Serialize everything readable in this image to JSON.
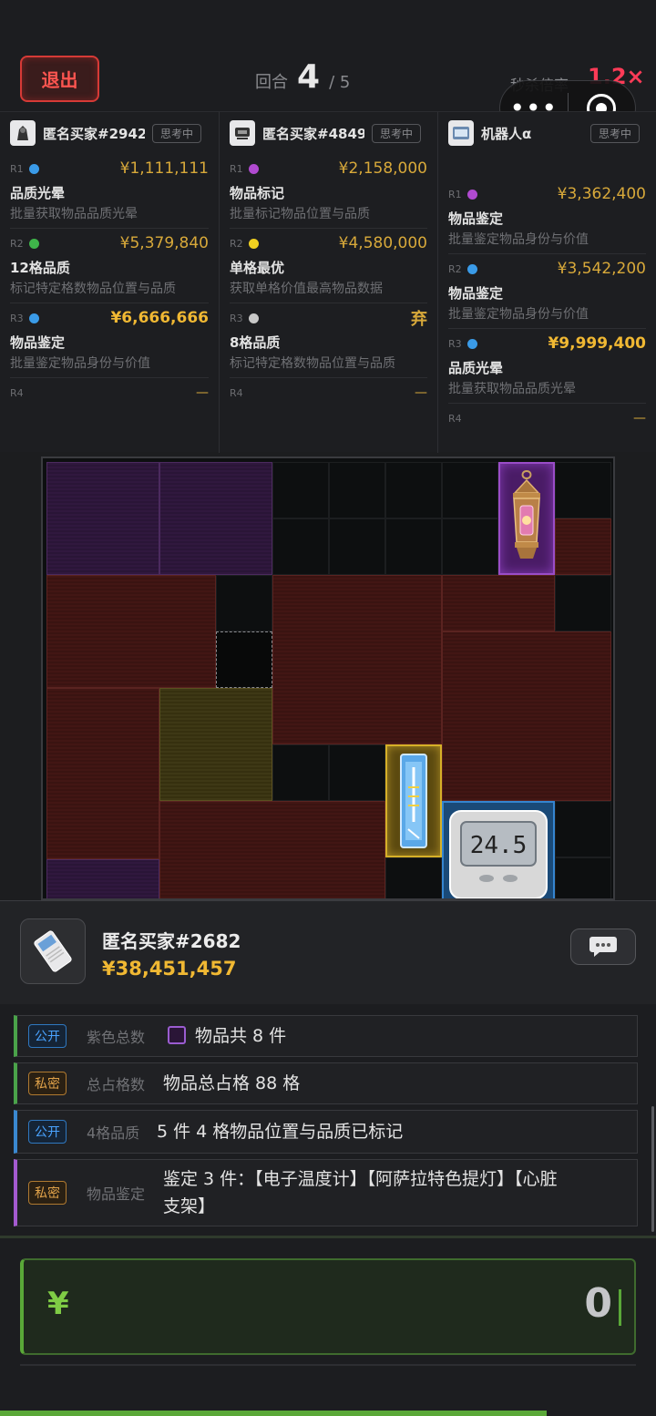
{
  "header": {
    "exit_label": "退出",
    "round_label": "回合",
    "round_current": "4",
    "round_total": "/ 5",
    "speed_label": "秒杀倍率",
    "speed_value": "1.2×",
    "capsule_dots": "•••"
  },
  "buyers": [
    {
      "name": "匿名买家#2942",
      "status": "思考中",
      "rounds": [
        {
          "label": "R1",
          "dot": "#3a9be8",
          "price": "¥1,111,111",
          "title": "品质光晕",
          "desc": "批量获取物品品质光晕"
        },
        {
          "label": "R2",
          "dot": "#3fb54a",
          "price": "¥5,379,840",
          "title": "12格品质",
          "desc": "标记特定格数物品位置与品质"
        },
        {
          "label": "R3",
          "dot": "#3a9be8",
          "price": "¥6,666,666",
          "title": "物品鉴定",
          "desc": "批量鉴定物品身份与价值"
        },
        {
          "label": "R4",
          "price": "—"
        }
      ]
    },
    {
      "name": "匿名买家#4849",
      "status": "思考中",
      "rounds": [
        {
          "label": "R1",
          "dot": "#b04ad0",
          "price": "¥2,158,000",
          "title": "物品标记",
          "desc": "批量标记物品位置与品质"
        },
        {
          "label": "R2",
          "dot": "#f0d020",
          "price": "¥4,580,000",
          "title": "单格最优",
          "desc": "获取单格价值最高物品数据"
        },
        {
          "label": "R3",
          "dot": "#c8c8c8",
          "price": "弃",
          "title": "8格品质",
          "desc": "标记特定格数物品位置与品质"
        },
        {
          "label": "R4",
          "price": "—"
        }
      ]
    },
    {
      "name": "机器人α",
      "status": "思考中",
      "rounds": [
        {
          "label": "R1",
          "dot": "#b04ad0",
          "price": "¥3,362,400",
          "title": "物品鉴定",
          "desc": "批量鉴定物品身份与价值"
        },
        {
          "label": "R2",
          "dot": "#3a9be8",
          "price": "¥3,542,200",
          "title": "物品鉴定",
          "desc": "批量鉴定物品身份与价值"
        },
        {
          "label": "R3",
          "dot": "#3a9be8",
          "price": "¥9,999,400",
          "title": "品质光晕",
          "desc": "批量获取物品品质光晕"
        },
        {
          "label": "R4",
          "price": "—"
        }
      ]
    }
  ],
  "board": {
    "items": [
      {
        "name": "阿萨拉特色提灯",
        "quality": "purple"
      },
      {
        "name": "心脏支架",
        "quality": "gold"
      },
      {
        "name": "电子温度计",
        "quality": "blue",
        "display": "24.5"
      }
    ]
  },
  "bidder": {
    "name": "匿名买家#2682",
    "total": "¥38,451,457"
  },
  "clues": [
    {
      "tag": "公开",
      "category": "紫色总数",
      "text": "物品共 8 件"
    },
    {
      "tag": "私密",
      "category": "总占格数",
      "text": "物品总占格 88 格"
    },
    {
      "tag": "公开",
      "category": "4格品质",
      "text": "5 件 4 格物品位置与品质已标记"
    },
    {
      "tag": "私密",
      "category": "物品鉴定",
      "text_line1": "鉴定 3 件：【电子温度计】【阿萨拉特色提灯】【心脏",
      "text_line2": "支架】"
    }
  ],
  "bid": {
    "currency": "¥",
    "value": "0"
  },
  "colors": {
    "accent_green": "#5aa838",
    "gold": "#f0b833",
    "danger": "#d63a36",
    "speed": "#ff3b57"
  }
}
